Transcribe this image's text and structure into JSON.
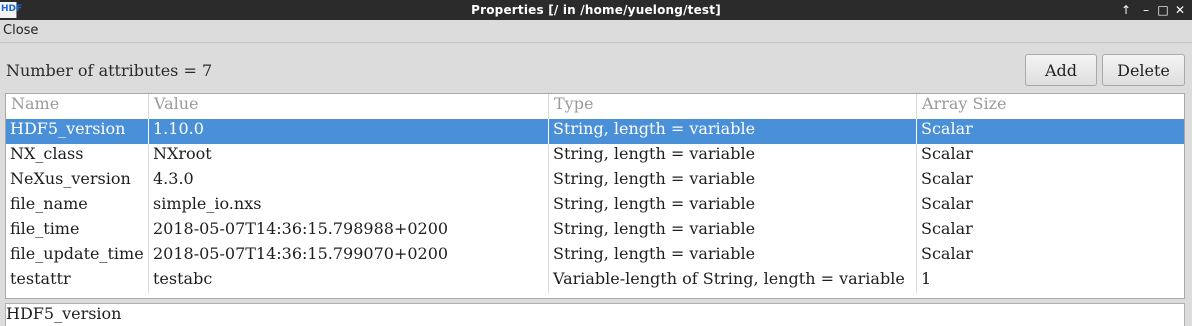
{
  "window": {
    "title": "Properties  [/  in  /home/yuelong/test]",
    "app_icon": "hdf-app-icon",
    "app_icon_text": "HDF",
    "controls": [
      "window-up-icon",
      "minimize-icon",
      "maximize-icon",
      "close-icon"
    ],
    "control_glyphs": {
      "up": "↑",
      "minimize": "–",
      "maximize": "□",
      "close": "✕"
    }
  },
  "menu": {
    "close_label": "Close"
  },
  "summary": {
    "count_label": "Number of attributes = 7"
  },
  "buttons": {
    "add_label": "Add",
    "delete_label": "Delete"
  },
  "table": {
    "columns": [
      "Name",
      "Value",
      "Type",
      "Array Size"
    ],
    "selected_row": 0,
    "rows": [
      [
        "HDF5_version",
        "1.10.0",
        "String, length = variable",
        "Scalar"
      ],
      [
        "NX_class",
        "NXroot",
        "String, length = variable",
        "Scalar"
      ],
      [
        "NeXus_version",
        "4.3.0",
        "String, length = variable",
        "Scalar"
      ],
      [
        "file_name",
        "simple_io.nxs",
        "String, length = variable",
        "Scalar"
      ],
      [
        "file_time",
        "2018-05-07T14:36:15.798988+0200",
        "String, length = variable",
        "Scalar"
      ],
      [
        "file_update_time",
        "2018-05-07T14:36:15.799070+0200",
        "String, length = variable",
        "Scalar"
      ],
      [
        "testattr",
        "testabc",
        "Variable-length of String, length = variable",
        "1"
      ]
    ]
  },
  "detail": {
    "text": "HDF5_version"
  },
  "colors": {
    "titlebar_bg": "#2b2b2b",
    "window_bg": "#dcdcdc",
    "selection": "#4a90d9",
    "header_text": "#9a9a9a"
  }
}
